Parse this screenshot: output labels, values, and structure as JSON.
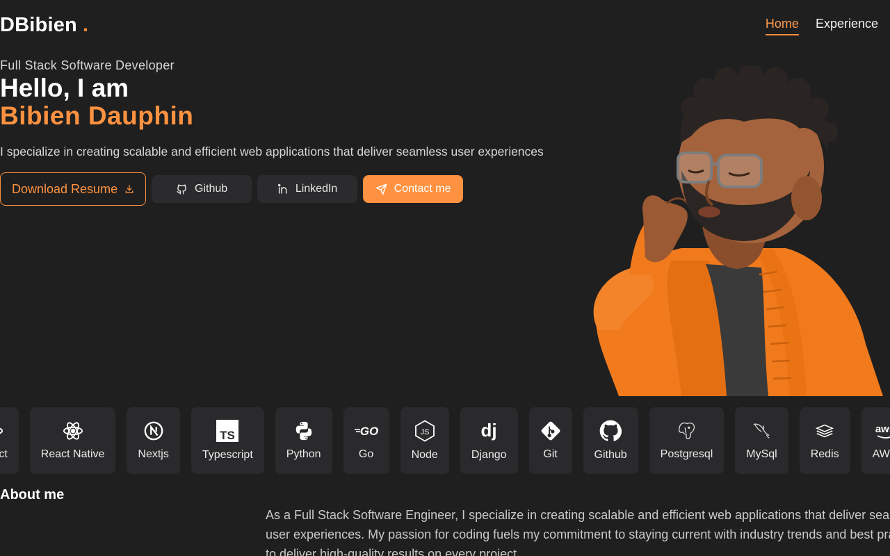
{
  "header": {
    "logo_text": "DBibien",
    "logo_dot": ".",
    "nav": [
      {
        "label": "Home",
        "active": true
      },
      {
        "label": "Experience",
        "active": false
      }
    ]
  },
  "hero": {
    "role": "Full Stack Software Developer",
    "greeting": "Hello, I am",
    "name": "Bibien Dauphin",
    "tagline": "I specialize in creating scalable and efficient web applications that deliver seamless user experiences",
    "buttons": {
      "resume": "Download Resume",
      "github": "Github",
      "linkedin": "LinkedIn",
      "contact": "Contact me"
    },
    "avatar_icon": "memoji-avatar"
  },
  "tech_stack": [
    {
      "label": "React",
      "icon": "react-icon"
    },
    {
      "label": "React Native",
      "icon": "react-icon"
    },
    {
      "label": "Nextjs",
      "icon": "nextjs-icon"
    },
    {
      "label": "Typescript",
      "icon": "typescript-icon"
    },
    {
      "label": "Python",
      "icon": "python-icon"
    },
    {
      "label": "Go",
      "icon": "go-icon"
    },
    {
      "label": "Node",
      "icon": "node-icon"
    },
    {
      "label": "Django",
      "icon": "django-icon"
    },
    {
      "label": "Git",
      "icon": "git-icon"
    },
    {
      "label": "Github",
      "icon": "github-icon"
    },
    {
      "label": "Postgresql",
      "icon": "postgresql-icon"
    },
    {
      "label": "MySql",
      "icon": "mysql-icon"
    },
    {
      "label": "Redis",
      "icon": "redis-icon"
    },
    {
      "label": "AWS",
      "icon": "aws-icon"
    }
  ],
  "about": {
    "title": "About me",
    "text": "As a Full Stack Software Engineer, I specialize in creating scalable and efficient web applications that deliver seamless user experiences. My passion for coding fuels my commitment to staying current with industry trends and best practices to deliver high-quality results on every project."
  },
  "colors": {
    "background": "#1f1f20",
    "accent": "#ff9240",
    "card": "#2a2a2c"
  }
}
